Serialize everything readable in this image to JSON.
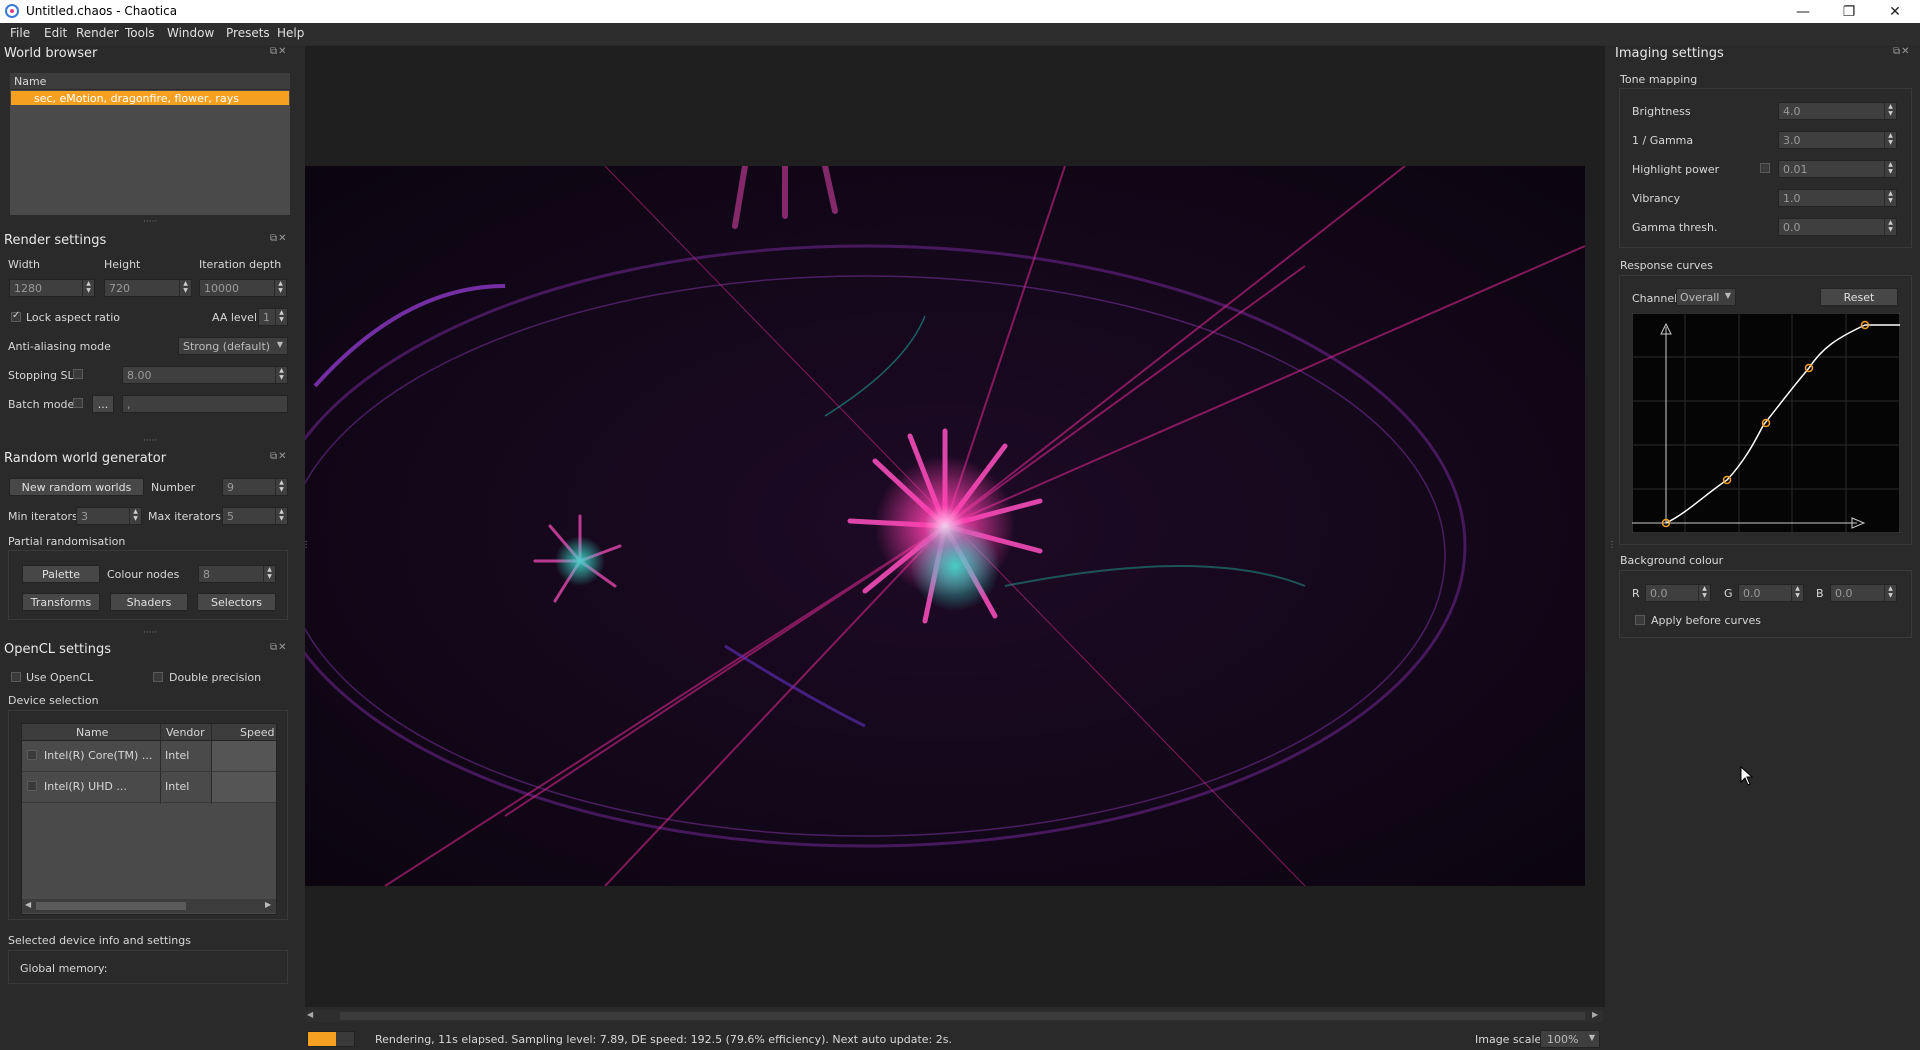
{
  "window": {
    "title": "Untitled.chaos - Chaotica",
    "min": "—",
    "max": "❐",
    "close": "✕"
  },
  "menu": [
    "File",
    "Edit",
    "Render",
    "Tools",
    "Window",
    "Presets",
    "Help"
  ],
  "world_browser": {
    "title": "World browser",
    "col_name": "Name",
    "selected_item": "sec, eMotion, dragonfire, flower, rays"
  },
  "render_settings": {
    "title": "Render settings",
    "width_label": "Width",
    "height_label": "Height",
    "depth_label": "Iteration depth",
    "width": "1280",
    "height": "720",
    "depth": "10000",
    "lock_label": "Lock aspect ratio",
    "aa_label": "AA level",
    "aa_value": "1",
    "aa_mode_label": "Anti-aliasing mode",
    "aa_mode_value": "Strong (default)",
    "stopping_label": "Stopping SL",
    "stopping_value": "8.00",
    "batch_label": "Batch mode",
    "batch_btn": "...",
    "batch_value": ","
  },
  "random_gen": {
    "title": "Random world generator",
    "new_btn": "New random worlds",
    "number_label": "Number",
    "number": "9",
    "min_label": "Min iterators",
    "min": "3",
    "max_label": "Max iterators",
    "max": "5",
    "partial_label": "Partial randomisation",
    "palette_btn": "Palette",
    "nodes_label": "Colour nodes",
    "nodes": "8",
    "transforms_btn": "Transforms",
    "shaders_btn": "Shaders",
    "selectors_btn": "Selectors"
  },
  "opencl": {
    "title": "OpenCL settings",
    "use_label": "Use OpenCL",
    "double_label": "Double precision",
    "device_label": "Device selection",
    "cols": [
      "Name",
      "Vendor",
      "Speed"
    ],
    "devices": [
      {
        "name": "Intel(R) Core(TM) ...",
        "vendor": "Intel",
        "speed": ""
      },
      {
        "name": "Intel(R) UHD ...",
        "vendor": "Intel",
        "speed": ""
      }
    ],
    "info_label": "Selected device info and settings",
    "memory_label": "Global memory:"
  },
  "imaging": {
    "title": "Imaging settings",
    "tone_label": "Tone mapping",
    "brightness_label": "Brightness",
    "brightness": "4.0",
    "gamma_label": "1 / Gamma",
    "gamma": "3.0",
    "highlight_label": "Highlight power",
    "highlight": "0.01",
    "vibrancy_label": "Vibrancy",
    "vibrancy": "1.0",
    "gthresh_label": "Gamma thresh.",
    "gthresh": "0.0",
    "curves_label": "Response curves",
    "channel_label": "Channel:",
    "channel_value": "Overall",
    "reset_btn": "Reset",
    "bg_label": "Background colour",
    "r_label": "R",
    "r": "0.0",
    "g_label": "G",
    "g": "0.0",
    "b_label": "B",
    "b": "0.0",
    "apply_label": "Apply before curves"
  },
  "status": {
    "text": "Rendering, 11s elapsed. Sampling level: 7.89, DE speed: 192.5 (79.6% efficiency). Next auto update: 2s.",
    "progress": 0.6,
    "scale_label": "Image scale:",
    "scale_value": "100%"
  },
  "colors": {
    "accent": "#f5a020",
    "panel": "#2a2a2a",
    "viewport": "#1f1f1f"
  }
}
